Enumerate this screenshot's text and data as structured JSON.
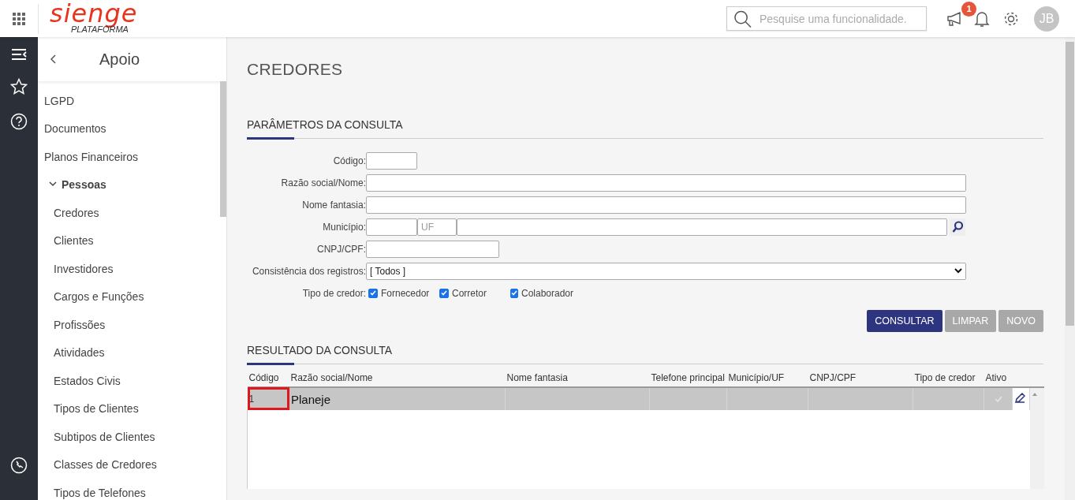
{
  "header": {
    "logo": "sienge",
    "logo_sub": "PLATAFORMA",
    "search": {
      "placeholder": "Pesquise uma funcionalidade."
    },
    "notification_badge": "1",
    "avatar": "JB"
  },
  "sidebar": {
    "title": "Apoio",
    "items": [
      {
        "label": "LGPD"
      },
      {
        "label": "Documentos"
      },
      {
        "label": "Planos Financeiros"
      },
      {
        "label": "Pessoas",
        "expanded": true,
        "children": [
          {
            "label": "Credores"
          },
          {
            "label": "Clientes"
          },
          {
            "label": "Investidores"
          },
          {
            "label": "Cargos e Funções"
          },
          {
            "label": "Profissões"
          },
          {
            "label": "Atividades"
          },
          {
            "label": "Estados Civis"
          },
          {
            "label": "Tipos de Clientes"
          },
          {
            "label": "Subtipos de Clientes"
          },
          {
            "label": "Classes de Credores"
          },
          {
            "label": "Tipos de Telefones"
          }
        ]
      }
    ]
  },
  "page": {
    "title": "CREDORES"
  },
  "parameters": {
    "title": "PARÂMETROS DA CONSULTA",
    "fields": [
      {
        "kind": "code",
        "label": "Código:"
      },
      {
        "kind": "text",
        "label": "Razão social/Nome:"
      },
      {
        "kind": "text",
        "label": "Nome fantasia:"
      },
      {
        "kind": "city",
        "label": "Município:",
        "uf_placeholder": "UF"
      },
      {
        "kind": "doc",
        "label": "CNPJ/CPF:"
      },
      {
        "kind": "select",
        "label": "Consistência dos registros:",
        "value": "[ Todos ]"
      },
      {
        "kind": "checkboxes",
        "label": "Tipo de credor:",
        "options": [
          {
            "label": "Fornecedor",
            "checked": true
          },
          {
            "label": "Corretor",
            "checked": true
          },
          {
            "label": "Colaborador",
            "checked": true
          }
        ]
      }
    ],
    "buttons": [
      {
        "label": "CONSULTAR",
        "disabled": false
      },
      {
        "label": "LIMPAR",
        "disabled": true
      },
      {
        "label": "NOVO",
        "disabled": true
      }
    ]
  },
  "results": {
    "title": "RESULTADO DA CONSULTA",
    "columns": [
      "Código",
      "Razão social/Nome",
      "Nome fantasia",
      "Telefone principal",
      "Município/UF",
      "CNPJ/CPF",
      "Tipo de credor",
      "Ativo"
    ],
    "rows": [
      {
        "code": "1",
        "name": "Planeje",
        "selected": true,
        "active": true,
        "highlighted": true
      }
    ]
  }
}
